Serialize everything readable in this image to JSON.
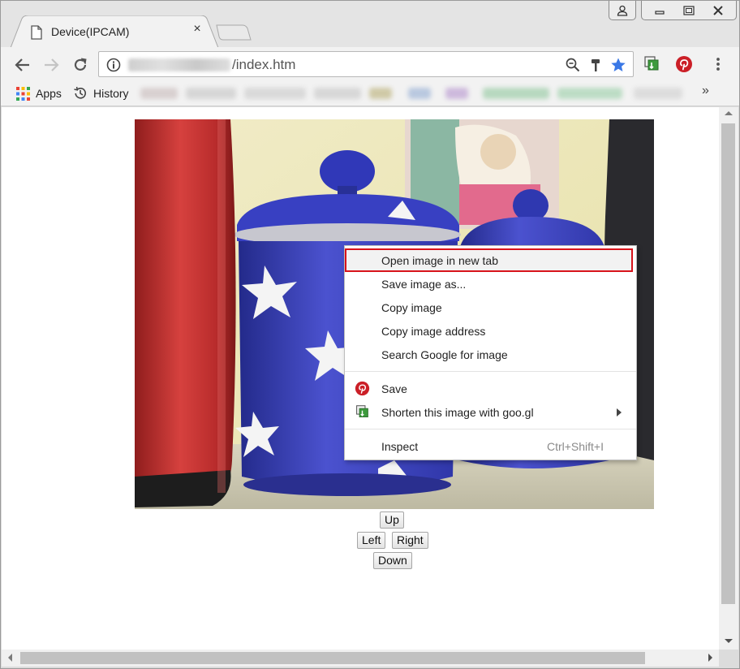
{
  "browser": {
    "tab_title": "Device(IPCAM)",
    "tab_close_glyph": "×",
    "url_suffix": "/index.htm",
    "more_glyph": "»"
  },
  "bookmarks": {
    "apps": "Apps",
    "history": "History"
  },
  "ptz": {
    "up": "Up",
    "left": "Left",
    "right": "Right",
    "down": "Down"
  },
  "context_menu": {
    "open_new_tab": "Open image in new tab",
    "save_as": "Save image as...",
    "copy_image": "Copy image",
    "copy_address": "Copy image address",
    "search_google": "Search Google for image",
    "pinterest_save": "Save",
    "shorten": "Shorten this image with goo.gl",
    "inspect": "Inspect",
    "inspect_shortcut": "Ctrl+Shift+I"
  },
  "icons": {
    "favicon": "page-icon",
    "back": "back-arrow-icon",
    "forward": "forward-arrow-icon",
    "reload": "reload-icon",
    "info": "info-icon",
    "zoom": "zoom-icon",
    "hammer": "hammer-icon",
    "star": "star-icon",
    "googl_ext": "googl-extension-icon",
    "pinterest": "pinterest-icon",
    "menu": "kebab-menu-icon"
  },
  "colors": {
    "star": "#3a78e6",
    "pinterest": "#cb1f27",
    "highlight_border": "#d8131b"
  }
}
